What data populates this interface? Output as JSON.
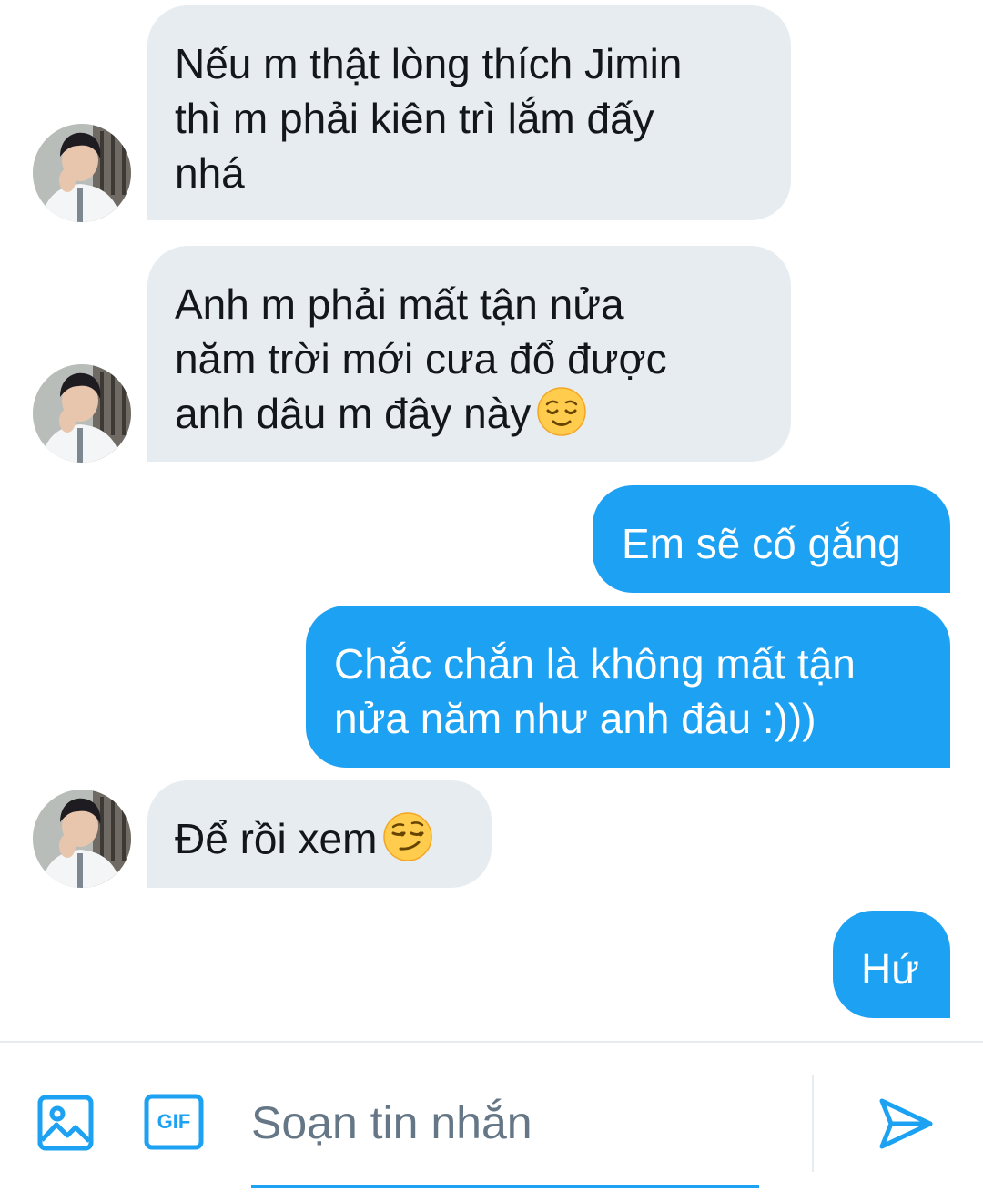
{
  "messages": [
    {
      "side": "received",
      "lines": [
        "Nếu m thật lòng thích Jimin",
        "thì m phải kiên trì lắm đấy",
        "nhá"
      ]
    },
    {
      "side": "received",
      "lines": [
        "Anh m phải mất tận nửa",
        "năm trời mới cưa đổ được",
        "anh dâu m đây này"
      ],
      "emoji": "relieved-face"
    },
    {
      "side": "sent",
      "lines": [
        "Em sẽ cố gắng"
      ]
    },
    {
      "side": "sent",
      "lines": [
        "Chắc chắn là không mất tận",
        "nửa năm như anh đâu :)))"
      ]
    },
    {
      "side": "received",
      "lines": [
        "Để rồi xem"
      ],
      "emoji": "smirking-face"
    },
    {
      "side": "sent",
      "lines": [
        "Hứ"
      ]
    }
  ],
  "composer": {
    "placeholder": "Soạn tin nhắn",
    "gif_label": "GIF",
    "icons": [
      "image-icon",
      "gif-icon",
      "send-icon"
    ]
  },
  "colors": {
    "received_bubble": "#e6ecf0",
    "sent_bubble": "#1da1f2",
    "accent": "#1da1f2",
    "placeholder": "#657786"
  }
}
